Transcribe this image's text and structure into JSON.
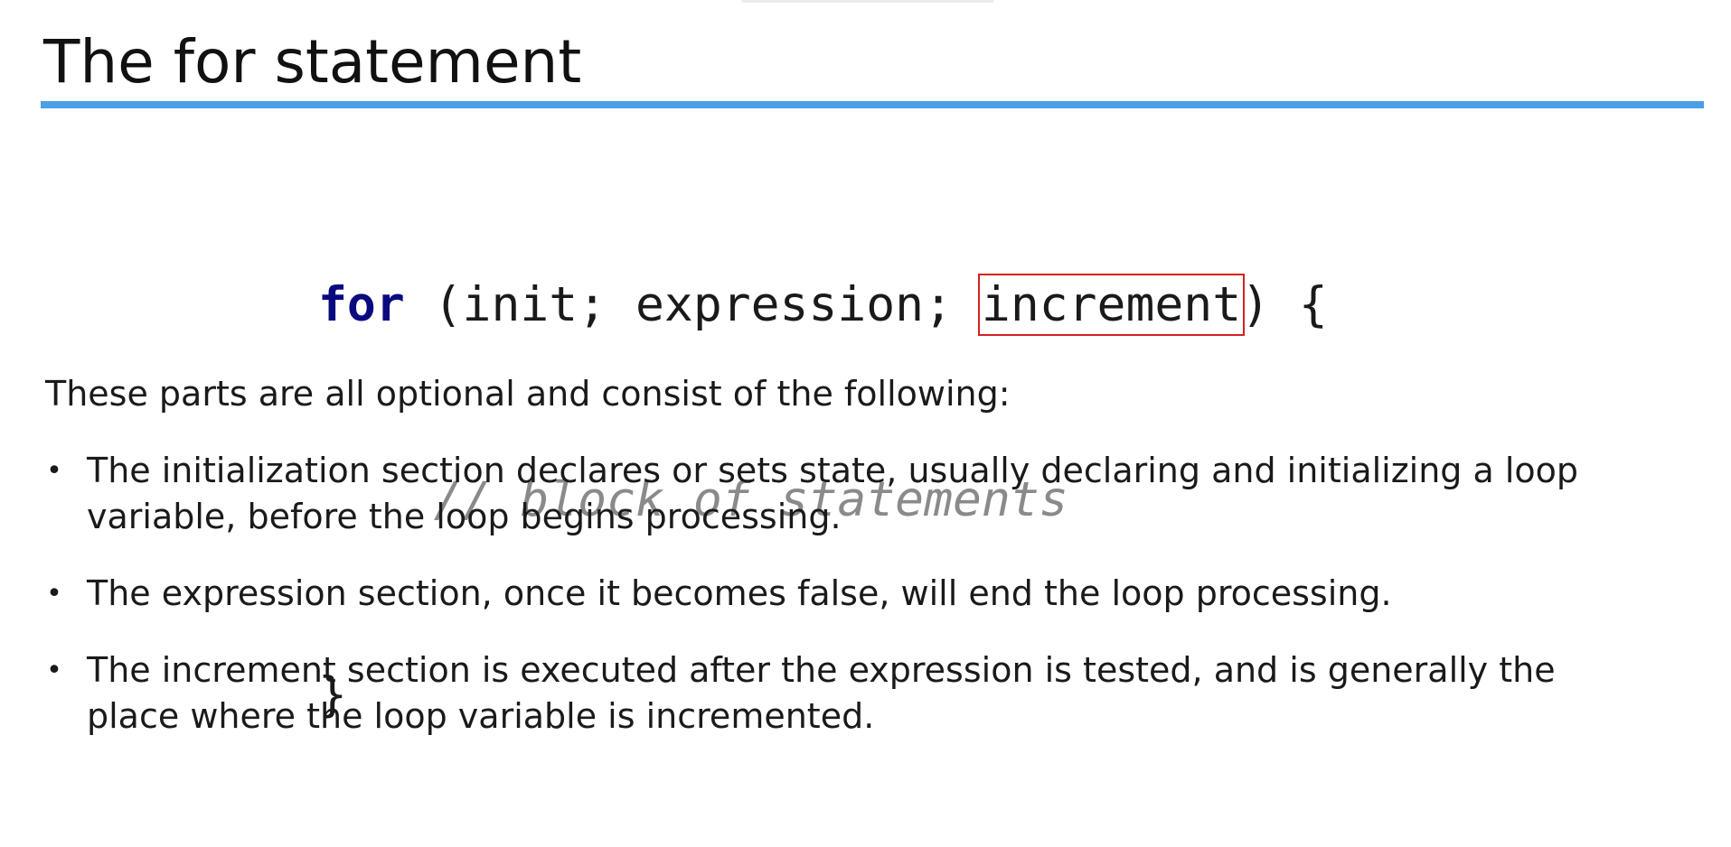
{
  "slide": {
    "title": "The for statement"
  },
  "code": {
    "line1": {
      "keyword": "for",
      "open": " (init; expression; ",
      "highlighted": "increment",
      "close": ") {"
    },
    "line2": {
      "indent": "    ",
      "comment": "// block of statements"
    },
    "line3": {
      "brace": "}"
    }
  },
  "content": {
    "intro": "These parts are all optional and consist of the following:",
    "bullets": [
      {
        "symbol": "•",
        "text": "The initialization section declares or sets state, usually declaring and initializing a loop variable, before the loop begins processing."
      },
      {
        "symbol": "•",
        "text": "The expression section, once it becomes false, will end the loop processing."
      },
      {
        "symbol": "•",
        "text": "The increment section is executed after the expression is tested, and is generally the place where the loop variable is incremented."
      }
    ]
  },
  "colors": {
    "title_rule": "#4a9fe6",
    "keyword": "#0a0a80",
    "comment": "#8a8a8a",
    "highlight_box": "#d62020"
  }
}
